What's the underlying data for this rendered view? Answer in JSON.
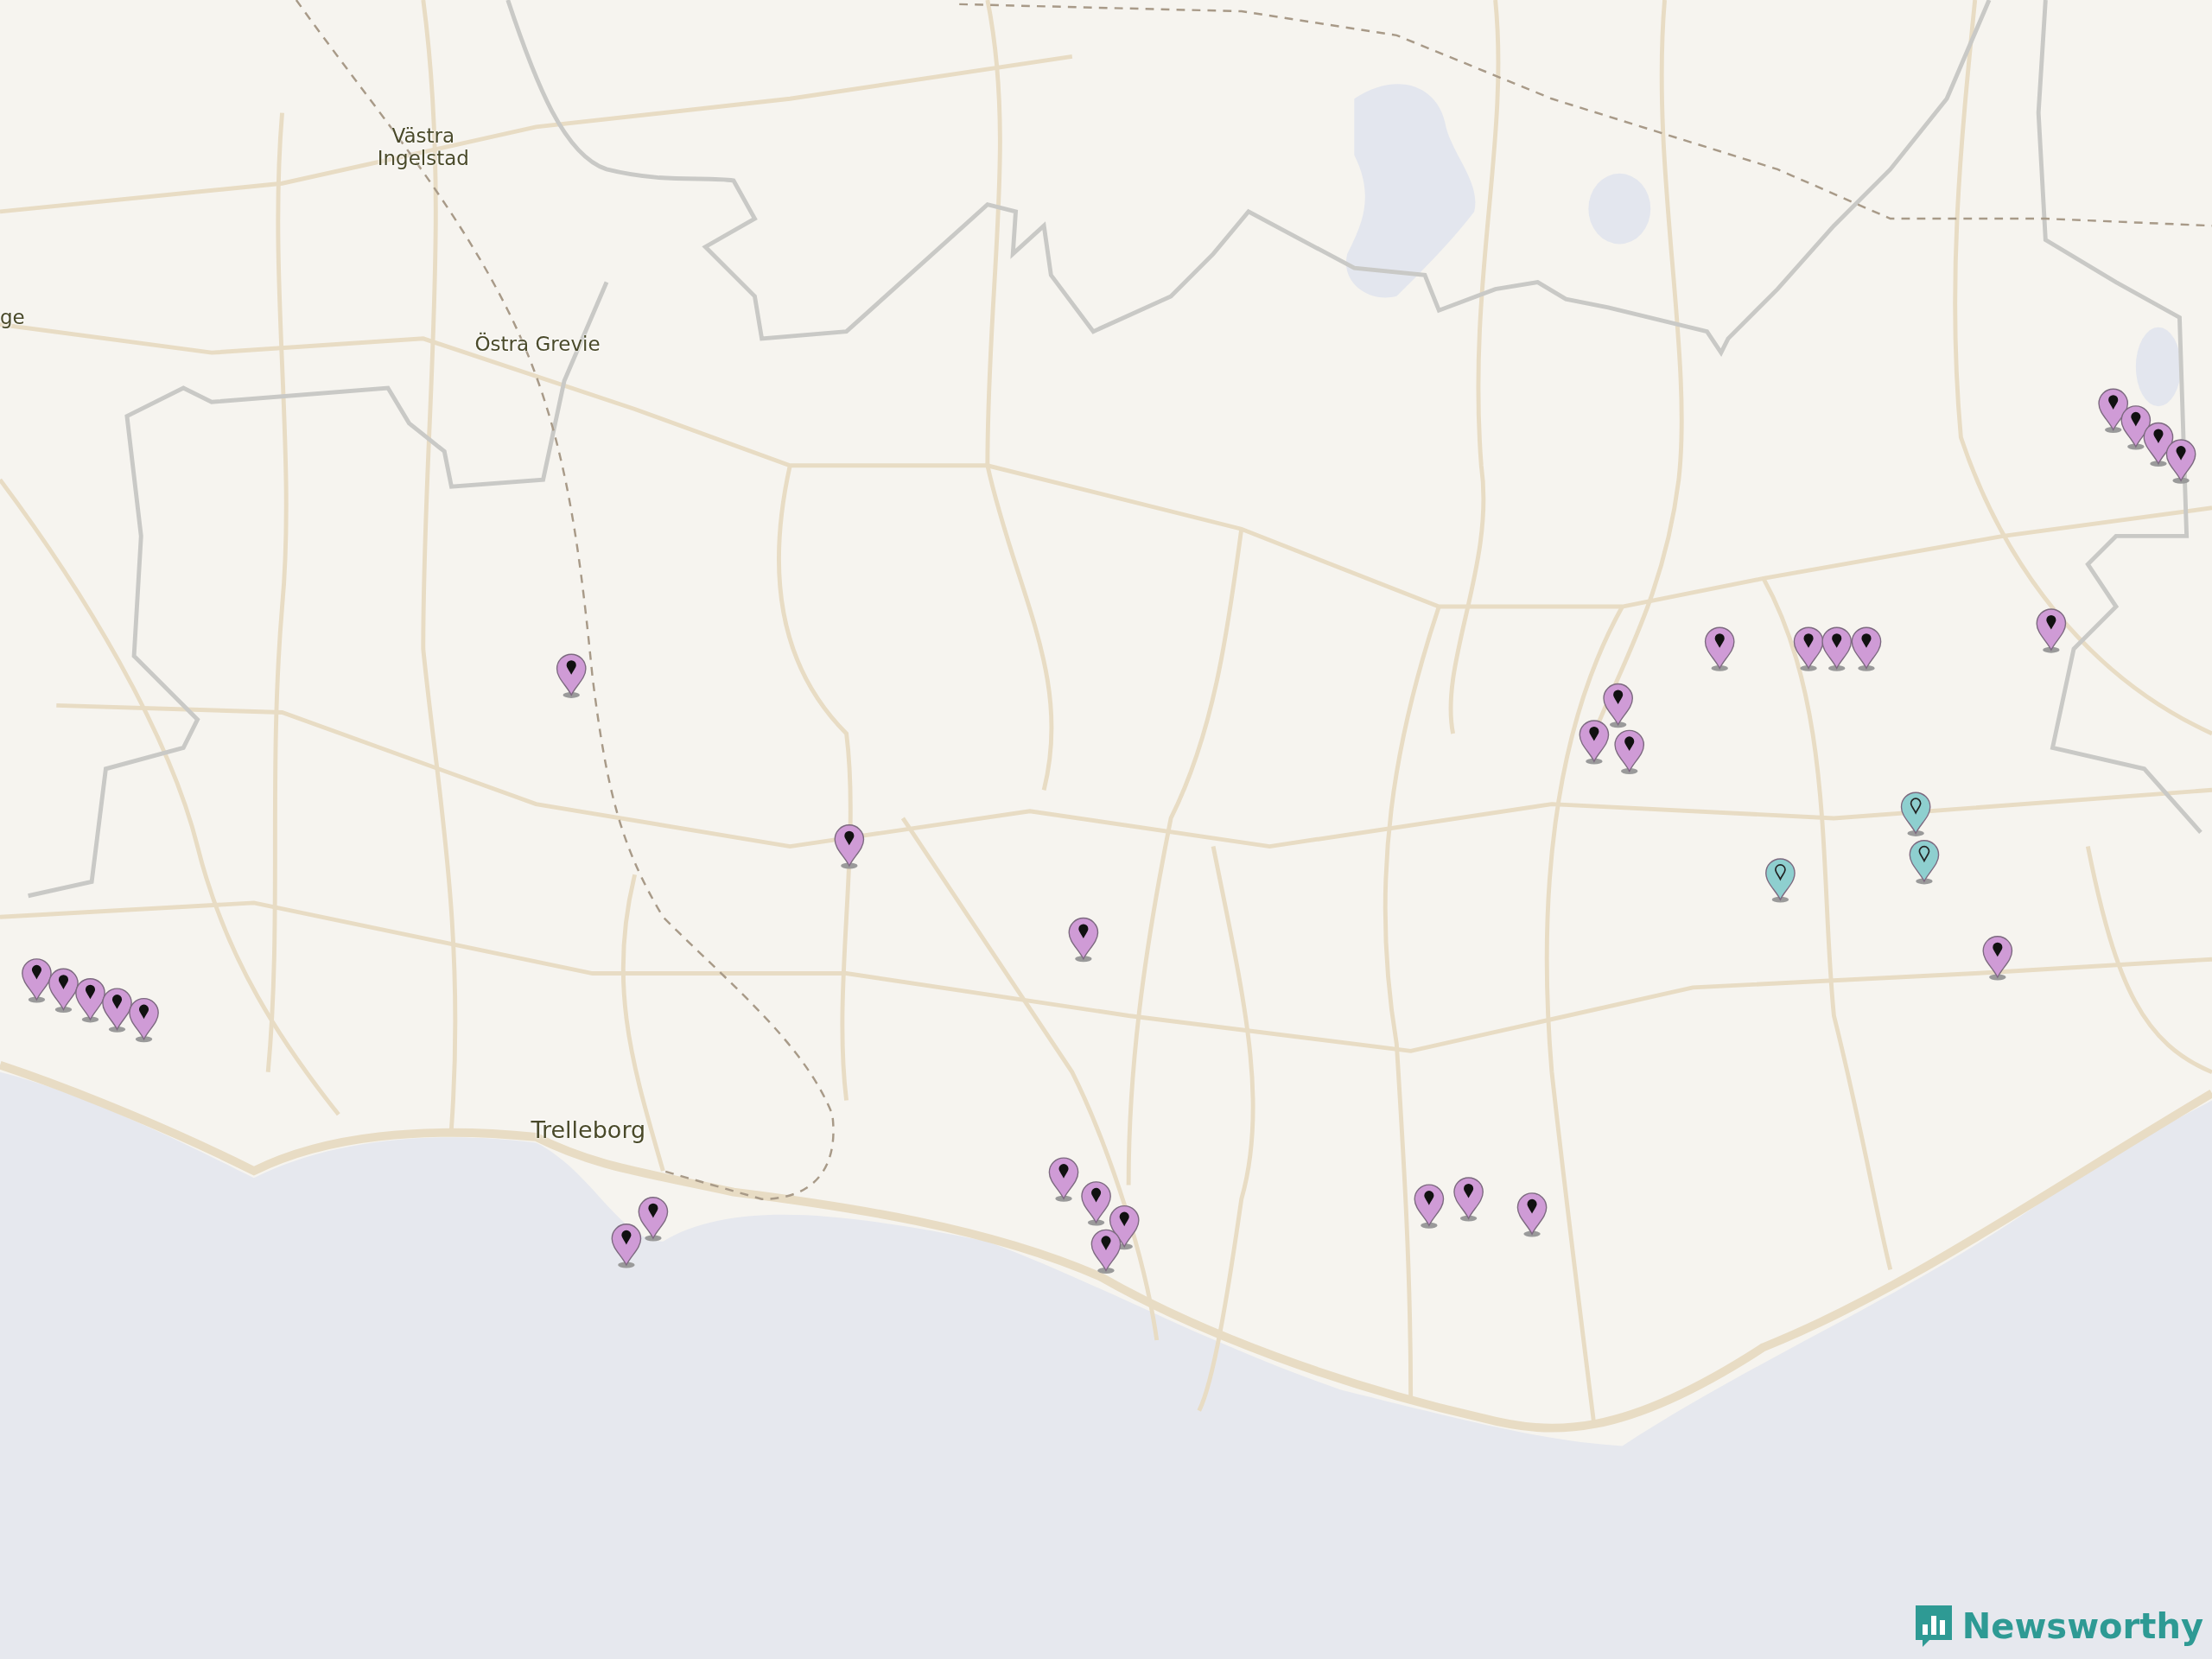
{
  "map": {
    "place_labels": [
      {
        "text": "Västra Ingelstad",
        "kind": "village"
      },
      {
        "text": "ge",
        "kind": "village"
      },
      {
        "text": "Östra Grevie",
        "kind": "village"
      },
      {
        "text": "Trelleborg",
        "kind": "town"
      }
    ],
    "pins": [
      {
        "color": "#cf9bd6",
        "kind": "filled"
      },
      {
        "color": "#cf9bd6",
        "kind": "filled"
      },
      {
        "color": "#cf9bd6",
        "kind": "filled"
      },
      {
        "color": "#cf9bd6",
        "kind": "filled"
      },
      {
        "color": "#cf9bd6",
        "kind": "filled"
      },
      {
        "color": "#cf9bd6",
        "kind": "filled"
      },
      {
        "color": "#cf9bd6",
        "kind": "filled"
      },
      {
        "color": "#cf9bd6",
        "kind": "filled"
      },
      {
        "color": "#cf9bd6",
        "kind": "filled"
      },
      {
        "color": "#cf9bd6",
        "kind": "filled"
      },
      {
        "color": "#cf9bd6",
        "kind": "filled"
      },
      {
        "color": "#cf9bd6",
        "kind": "filled"
      },
      {
        "color": "#cf9bd6",
        "kind": "filled"
      },
      {
        "color": "#cf9bd6",
        "kind": "filled"
      },
      {
        "color": "#cf9bd6",
        "kind": "filled"
      },
      {
        "color": "#cf9bd6",
        "kind": "filled"
      },
      {
        "color": "#cf9bd6",
        "kind": "filled"
      },
      {
        "color": "#cf9bd6",
        "kind": "filled"
      },
      {
        "color": "#cf9bd6",
        "kind": "filled"
      },
      {
        "color": "#cf9bd6",
        "kind": "filled"
      },
      {
        "color": "#cf9bd6",
        "kind": "filled"
      },
      {
        "color": "#cf9bd6",
        "kind": "filled"
      },
      {
        "color": "#cf9bd6",
        "kind": "filled"
      },
      {
        "color": "#cf9bd6",
        "kind": "filled"
      },
      {
        "color": "#cf9bd6",
        "kind": "filled"
      },
      {
        "color": "#cf9bd6",
        "kind": "filled"
      },
      {
        "color": "#cf9bd6",
        "kind": "filled"
      },
      {
        "color": "#cf9bd6",
        "kind": "filled"
      },
      {
        "color": "#cf9bd6",
        "kind": "filled"
      },
      {
        "color": "#cf9bd6",
        "kind": "filled"
      },
      {
        "color": "#8ecfcf",
        "kind": "hollow"
      },
      {
        "color": "#8ecfcf",
        "kind": "hollow"
      },
      {
        "color": "#8ecfcf",
        "kind": "hollow"
      }
    ]
  },
  "brand": {
    "name": "Newsworthy"
  }
}
